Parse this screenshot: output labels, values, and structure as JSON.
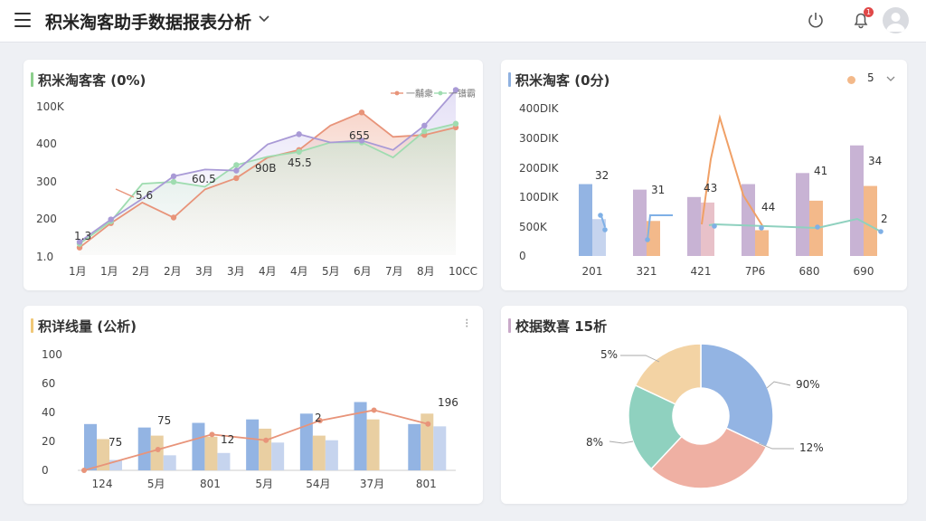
{
  "header": {
    "title": "积米淘客助手数据报表分析",
    "menu_icon": "menu-icon",
    "power_icon": "power-icon",
    "bell_icon": "bell-icon",
    "notification_count": "1",
    "avatar_icon": "user-avatar-icon"
  },
  "cards": [
    {
      "title": "积米淘客客 (0%)",
      "accent": "#8ccf8c"
    },
    {
      "title": "积米淘客 (0分)",
      "accent": "#8fb1e0",
      "legend_value": "5"
    },
    {
      "title": "积详线量 (公析)",
      "accent": "#f0c878",
      "menu": "⁝"
    },
    {
      "title": "校据数喜 15析",
      "accent": "#c9a9c9"
    }
  ],
  "colors": {
    "blue": "#93b4e3",
    "purple": "#a99ad6",
    "orange": "#e8947a",
    "green": "#9fdcb0",
    "beige": "#e9cfa2",
    "mauve": "#c8b3d4",
    "peach": "#f3b98a",
    "teal": "#8fd1bf",
    "light_blue": "#c6d4ee"
  },
  "chart_data": [
    {
      "type": "area",
      "title": "积米淘客客 (0%)",
      "categories": [
        "1月",
        "1月",
        "2月",
        "2月",
        "3月",
        "3月",
        "4月",
        "4月",
        "5月",
        "6月",
        "7月",
        "8月",
        "10CC"
      ],
      "yticks": [
        "100K",
        "400",
        "300",
        "200",
        "1.0"
      ],
      "ylim": [
        0,
        400
      ],
      "legend": [
        "一黼衆",
        "一镨霸"
      ],
      "legend_position": "top-right",
      "series": [
        {
          "name": "一黼衆",
          "values": [
            20,
            85,
            140,
            100,
            175,
            205,
            260,
            280,
            345,
            380,
            315,
            320,
            340
          ]
        },
        {
          "name": "一镨霸",
          "values": [
            30,
            90,
            190,
            195,
            182,
            240,
            262,
            275,
            300,
            300,
            260,
            330,
            350
          ]
        },
        {
          "values": [
            35,
            95,
            150,
            210,
            228,
            225,
            295,
            322,
            300,
            305,
            280,
            345,
            440
          ]
        }
      ],
      "data_labels": [
        "1.3",
        "5.6",
        "60.5",
        "90B",
        "45.5",
        "655"
      ]
    },
    {
      "type": "bar",
      "title": "积米淘客 (0分)",
      "categories": [
        "201",
        "321",
        "421",
        "7P6",
        "680",
        "690"
      ],
      "yticks": [
        "400DIK",
        "300DIK",
        "200DIK",
        "100DIK",
        "500K",
        "0"
      ],
      "ylim": [
        0,
        400
      ],
      "series": [
        {
          "values": [
            195,
            180,
            160,
            195,
            225,
            300
          ]
        },
        {
          "values": [
            100,
            95,
            145,
            70,
            150,
            190
          ]
        }
      ],
      "line_values": [
        140,
        40,
        120,
        390,
        110,
        100,
        130,
        80,
        70,
        100
      ],
      "data_labels": [
        "32",
        "31",
        "43",
        "44",
        "41",
        "34",
        "2"
      ]
    },
    {
      "type": "bar",
      "title": "积详线量 (公析)",
      "categories": [
        "124",
        "5月",
        "801",
        "5月",
        "54月",
        "37月",
        "801"
      ],
      "yticks": [
        "100",
        "60",
        "40",
        "20",
        "0"
      ],
      "ylim": [
        0,
        100
      ],
      "series": [
        {
          "values": [
            40,
            37,
            41,
            44,
            49,
            59,
            40
          ]
        },
        {
          "values": [
            27,
            30,
            29,
            36,
            30,
            44,
            49
          ]
        },
        {
          "values": [
            9,
            13,
            15,
            24,
            26,
            0,
            38
          ]
        }
      ],
      "line_values": [
        0,
        18,
        31,
        26,
        43,
        52,
        40
      ],
      "data_labels": [
        "75",
        "75",
        "12",
        "2",
        "196"
      ]
    },
    {
      "type": "pie",
      "title": "校据数喜 15析",
      "slices": [
        {
          "label": "90%",
          "value": 32
        },
        {
          "label": "12%",
          "value": 30
        },
        {
          "label": "8%",
          "value": 20
        },
        {
          "label": "5%",
          "value": 18
        }
      ]
    }
  ]
}
